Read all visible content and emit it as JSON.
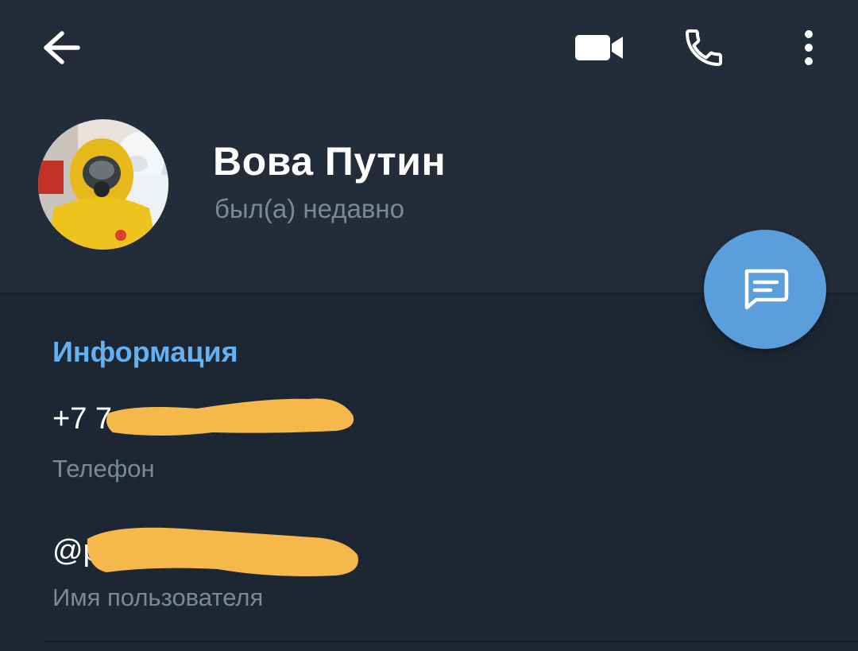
{
  "toolbar": {
    "back_icon": "back-arrow-icon",
    "video_icon": "video-camera-icon",
    "phone_icon": "phone-icon",
    "more_icon": "more-vertical-icon"
  },
  "profile": {
    "name": "Вова Путин",
    "status": "был(а) недавно",
    "avatar_icon": "profile-avatar-photo"
  },
  "fab": {
    "icon": "message-icon"
  },
  "info": {
    "title": "Информация",
    "phone_value": "+7 7",
    "phone_label": "Телефон",
    "username_value": "@p",
    "username_label": "Имя пользователя"
  },
  "colors": {
    "background": "#1d2733",
    "header": "#222d39",
    "accent": "#64b0f0",
    "fab": "#5a9edb",
    "redaction": "#f7b84b"
  }
}
